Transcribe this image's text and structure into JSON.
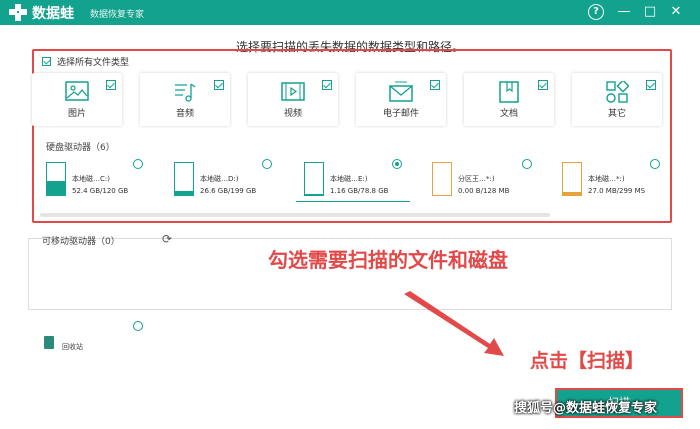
{
  "app": {
    "name": "数据蛙",
    "subtitle": "数据恢复专家"
  },
  "titlebar_icons": {
    "help": "?",
    "minimize": "—",
    "maximize": "□",
    "close": "✕"
  },
  "instruction": "选择要扫描的丢失数据的数据类型和路径。",
  "select_all_label": "选择所有文件类型",
  "file_types": [
    {
      "label": "图片",
      "icon": "image-icon",
      "checked": true
    },
    {
      "label": "音频",
      "icon": "music-icon",
      "checked": true
    },
    {
      "label": "视频",
      "icon": "video-icon",
      "checked": true
    },
    {
      "label": "电子邮件",
      "icon": "email-icon",
      "checked": true
    },
    {
      "label": "文档",
      "icon": "document-icon",
      "checked": true
    },
    {
      "label": "其它",
      "icon": "other-icon",
      "checked": true
    }
  ],
  "disk_section_title": "硬盘驱动器（6）",
  "disks": [
    {
      "name": "本地磁…C:)",
      "size": "52.4 GB/120 GB",
      "fill": 0.44,
      "selected": false,
      "color": "#13a28d"
    },
    {
      "name": "本地磁…D:)",
      "size": "26.6 GB/199 GB",
      "fill": 0.13,
      "selected": false,
      "color": "#13a28d"
    },
    {
      "name": "本地磁…E:)",
      "size": "1.16 GB/78.8 GB",
      "fill": 0.02,
      "selected": true,
      "color": "#13a28d"
    },
    {
      "name": "分区王…*:)",
      "size": "0.00  B/128 MB",
      "fill": 0.0,
      "selected": false,
      "color": "#e6a23c"
    },
    {
      "name": "本地磁…*:)",
      "size": "27.0 MB/299 MS",
      "fill": 0.09,
      "selected": false,
      "color": "#e6a23c"
    }
  ],
  "removable_section_title": "可移动驱动器（0）",
  "recycle_label": "回收站",
  "annotations": {
    "select_hint": "勾选需要扫描的文件和磁盘",
    "click_hint": "点击【扫描】"
  },
  "scan_button": "扫描",
  "watermark": "搜狐号@数据蛙恢复专家",
  "colors": {
    "brand": "#13a28d",
    "annotation": "#e24a4a",
    "partition_orange": "#e6a23c"
  }
}
